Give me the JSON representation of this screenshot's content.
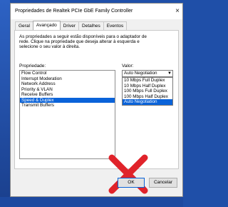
{
  "window": {
    "title": "Propriedades de Realtek PCIe GbE Family Controller",
    "close_glyph": "×"
  },
  "tabs": [
    {
      "label": "Geral"
    },
    {
      "label": "Avançado"
    },
    {
      "label": "Driver"
    },
    {
      "label": "Detalhes"
    },
    {
      "label": "Eventos"
    }
  ],
  "description": {
    "lines": [
      "As propriedades a seguir estão disponíveis para o adaptador de",
      "rede. Clique na propriedade que deseja alterar à esquerda e",
      "selecione o seu valor à direita."
    ]
  },
  "properties": {
    "label": "Propriedade:",
    "items": [
      "Flow Control",
      "Interrupt Moderation",
      "Network Address",
      "Priority & VLAN",
      "Receive Buffers",
      "Speed & Duplex",
      "Transmit Buffers"
    ],
    "selected": "Speed & Duplex"
  },
  "value": {
    "label": "Valor:",
    "current": "Auto Negotiation",
    "options": [
      "10 Mbps Full Duplex",
      "10 Mbps Half Duplex",
      "100 Mbps Full Duplex",
      "100 Mbps Half Duplex",
      "Auto Negotiation"
    ],
    "highlighted": "Auto Negotiation"
  },
  "overlay": {
    "icon": "red-x-icon",
    "color": "#e0232a"
  },
  "buttons": {
    "ok_label": "OK",
    "cancel_label": "Cancelar"
  },
  "colors": {
    "selection": "#0a63d9",
    "backdrop": "#1f4fa8"
  }
}
